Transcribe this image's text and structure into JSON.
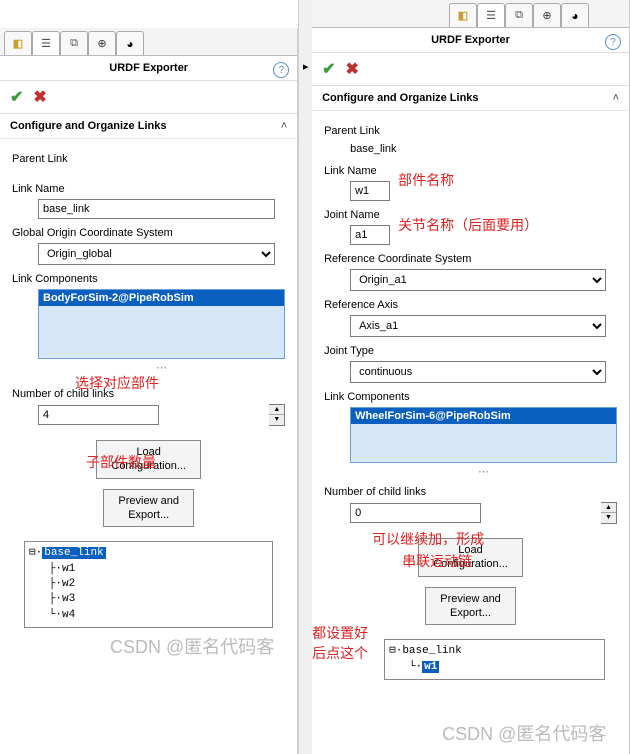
{
  "left": {
    "title": "URDF Exporter",
    "section_title": "Configure and Organize Links",
    "parent_link_label": "Parent Link",
    "link_name_label": "Link Name",
    "link_name_value": "base_link",
    "global_origin_label": "Global Origin Coordinate System",
    "global_origin_value": "Origin_global",
    "link_components_label": "Link Components",
    "selected_component": "BodyForSim-2@PipeRobSim",
    "annotation_select": "选择对应部件",
    "child_links_label": "Number of child links",
    "child_links_value": "4",
    "annotation_child": "子部件数量",
    "btn_load": "Load\nConfiguration...",
    "btn_preview": "Preview and\nExport...",
    "tree_root": "base_link",
    "tree_children": [
      "w1",
      "w2",
      "w3",
      "w4"
    ],
    "watermark": "CSDN @匿名代码客"
  },
  "right": {
    "title": "URDF Exporter",
    "section_title": "Configure and Organize Links",
    "parent_link_label": "Parent Link",
    "parent_link_value": "base_link",
    "link_name_label": "Link Name",
    "link_name_value": "w1",
    "annotation_linkname": "部件名称",
    "joint_name_label": "Joint Name",
    "joint_name_value": "a1",
    "annotation_jointname": "关节名称（后面要用）",
    "ref_coord_label": "Reference Coordinate System",
    "ref_coord_value": "Origin_a1",
    "ref_axis_label": "Reference Axis",
    "ref_axis_value": "Axis_a1",
    "joint_type_label": "Joint Type",
    "joint_type_value": "continuous",
    "link_components_label": "Link Components",
    "selected_component": "WheelForSim-6@PipeRobSim",
    "child_links_label": "Number of child links",
    "child_links_value": "0",
    "annotation_child1": "可以继续加，形成",
    "annotation_child2": "串联运动链",
    "btn_load": "Load\nConfiguration...",
    "btn_preview": "Preview and\nExport...",
    "annotation_preview1": "都设置好",
    "annotation_preview2": "后点这个",
    "tree_root": "base_link",
    "tree_child": "w1",
    "watermark": "CSDN @匿名代码客"
  }
}
